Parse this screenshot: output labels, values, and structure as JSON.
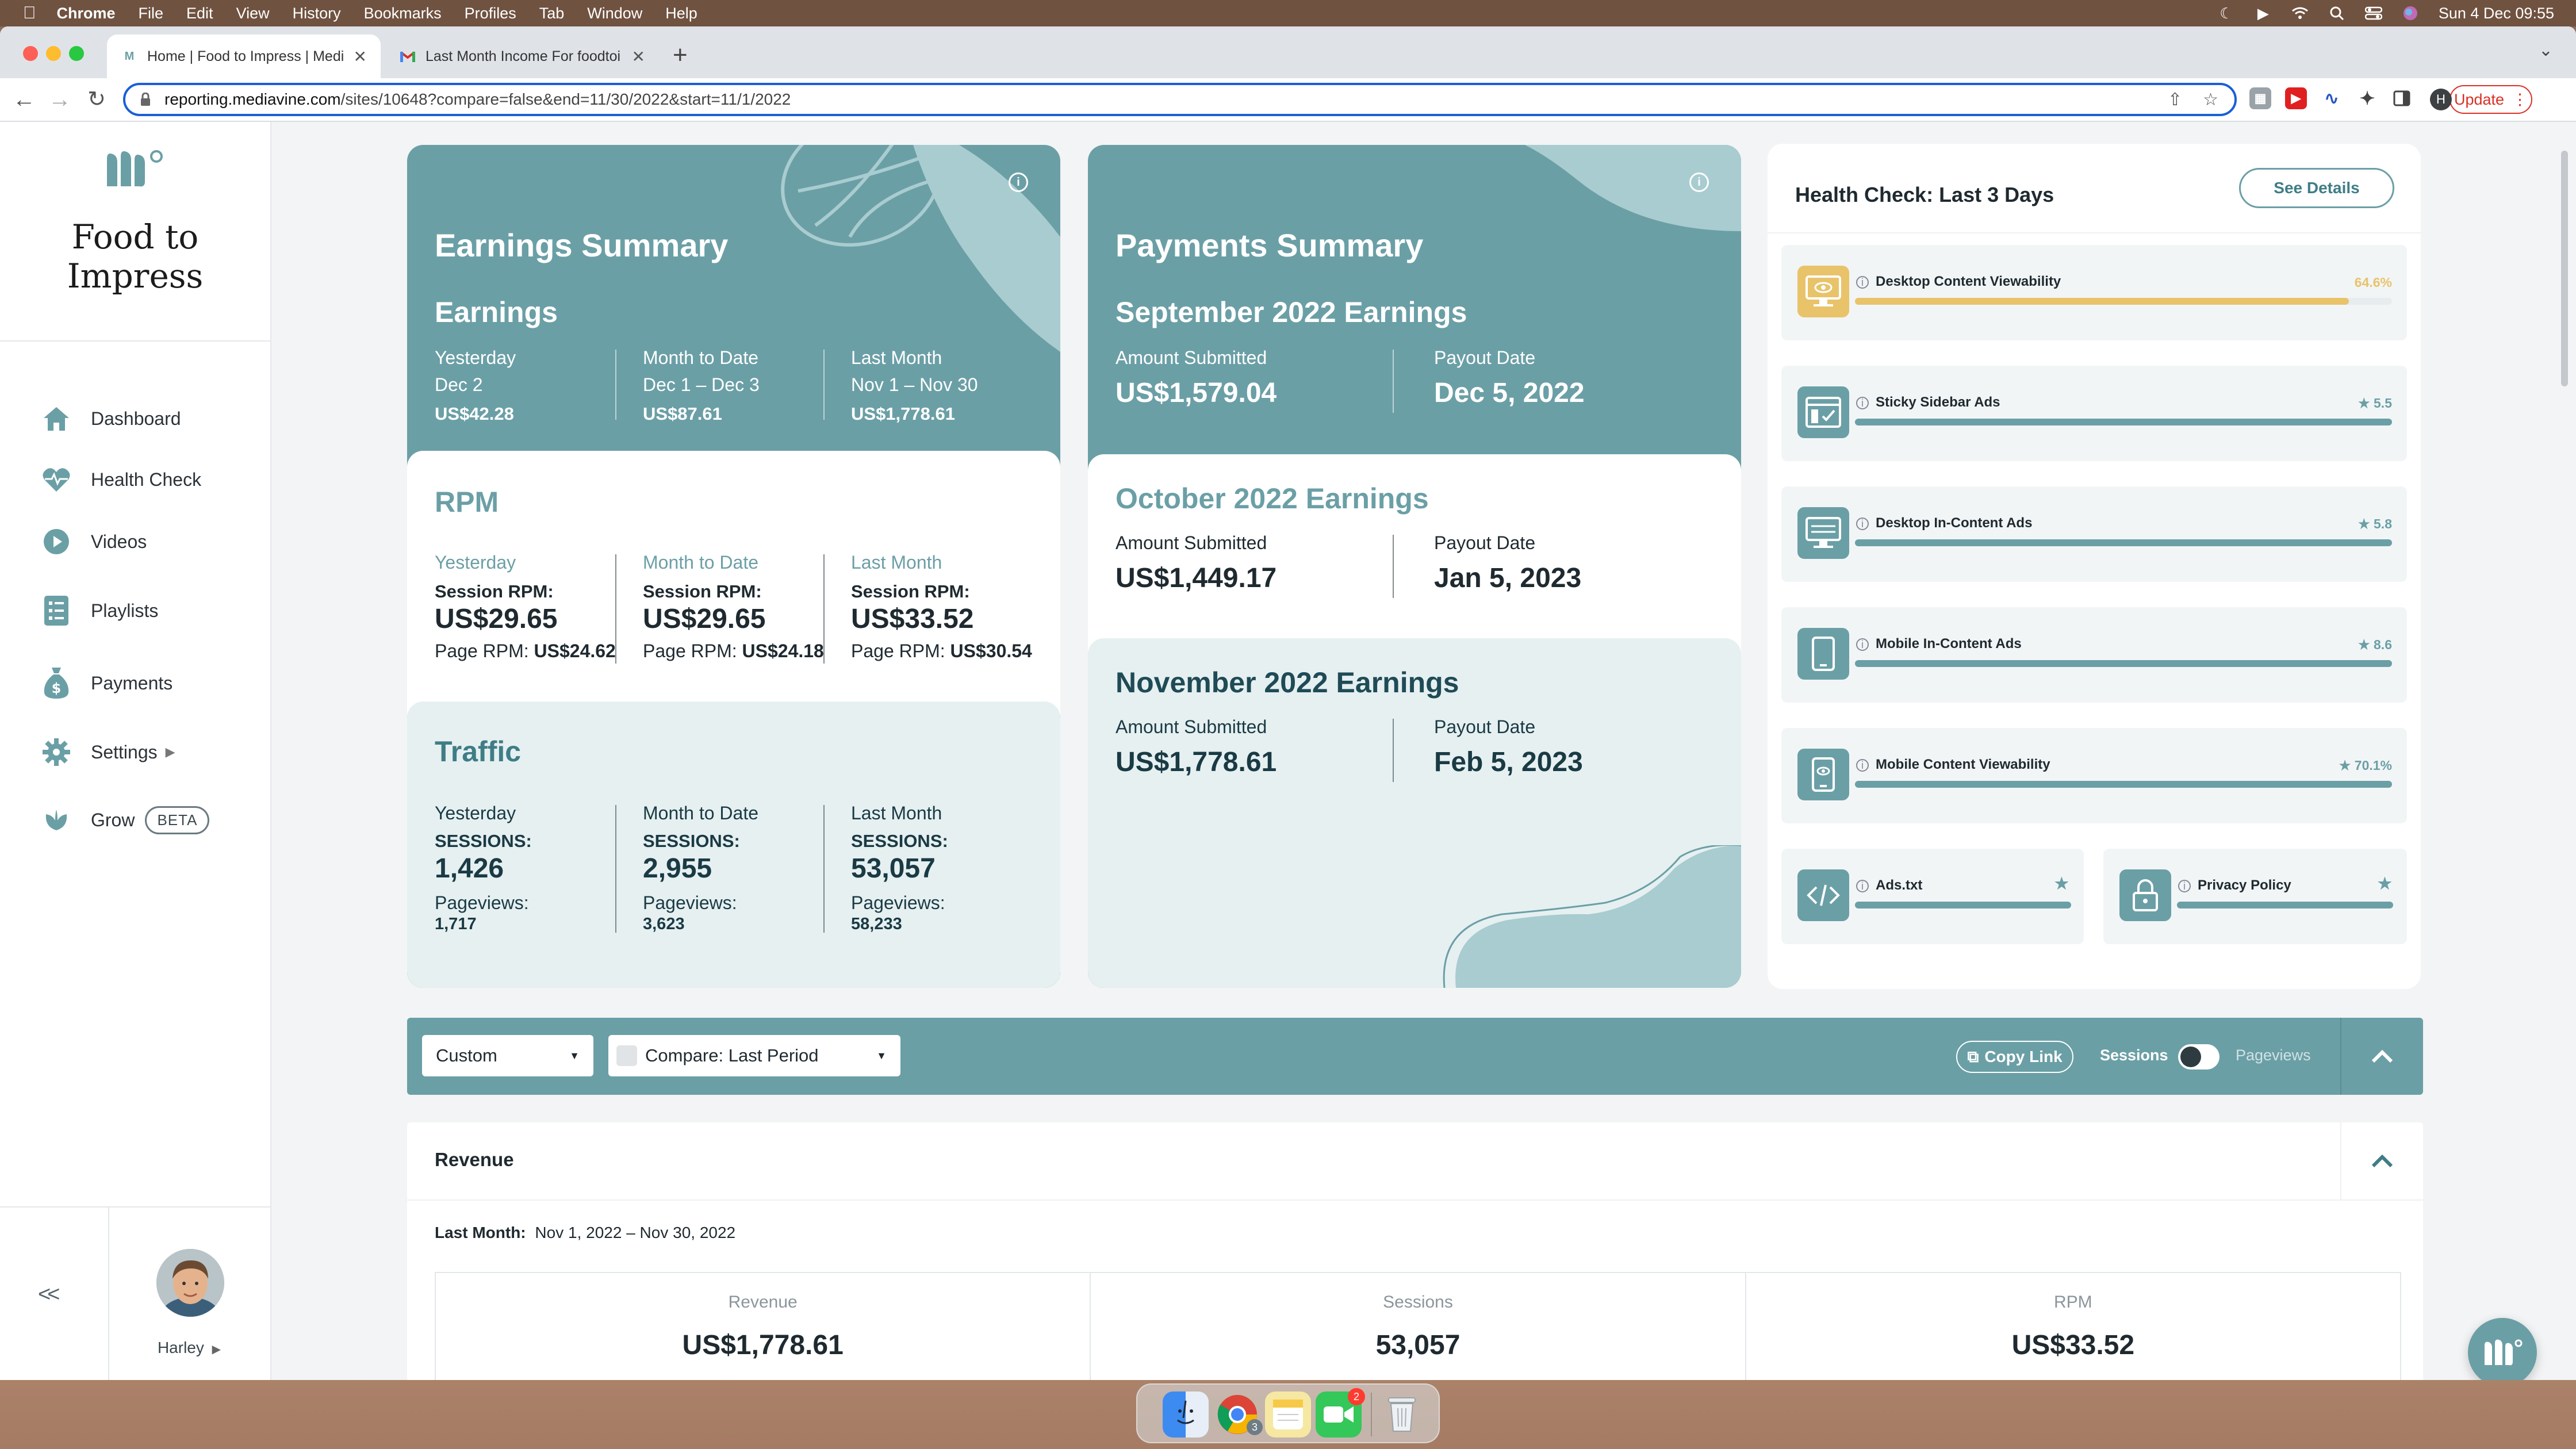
{
  "menubar": {
    "app": "Chrome",
    "items": [
      "File",
      "Edit",
      "View",
      "History",
      "Bookmarks",
      "Profiles",
      "Tab",
      "Window",
      "Help"
    ],
    "clock": "Sun 4 Dec  09:55"
  },
  "browser": {
    "tabs": [
      {
        "title": "Home | Food to Impress | Medi"
      },
      {
        "title": "Last Month Income For foodtoi"
      }
    ],
    "url_host": "reporting.mediavine.com",
    "url_path": "/sites/10648?compare=false&end=11/30/2022&start=11/1/2022",
    "update_label": "Update",
    "profile_initial": "H"
  },
  "sidebar": {
    "site_name_line1": "Food to",
    "site_name_line2": "Impress",
    "nav": [
      {
        "label": "Dashboard"
      },
      {
        "label": "Health Check"
      },
      {
        "label": "Videos"
      },
      {
        "label": "Playlists"
      },
      {
        "label": "Payments"
      },
      {
        "label": "Settings"
      },
      {
        "label": "Grow",
        "badge": "BETA"
      }
    ],
    "collapse_label": "<<",
    "user_name": "Harley"
  },
  "earnings": {
    "title": "Earnings Summary",
    "subtitle": "Earnings",
    "cols": [
      {
        "period": "Yesterday",
        "range": "Dec 2",
        "value": "US$42.28"
      },
      {
        "period": "Month to Date",
        "range": "Dec 1 – Dec 3",
        "value": "US$87.61"
      },
      {
        "period": "Last Month",
        "range": "Nov 1 – Nov 30",
        "value": "US$1,778.61"
      }
    ]
  },
  "rpm": {
    "title": "RPM",
    "session_label": "Session RPM:",
    "page_label": "Page RPM:",
    "cols": [
      {
        "period": "Yesterday",
        "session": "US$29.65",
        "page": "US$24.62"
      },
      {
        "period": "Month to Date",
        "session": "US$29.65",
        "page": "US$24.18"
      },
      {
        "period": "Last Month",
        "session": "US$33.52",
        "page": "US$30.54"
      }
    ]
  },
  "traffic": {
    "title": "Traffic",
    "sessions_label": "SESSIONS:",
    "pageviews_label": "Pageviews:",
    "cols": [
      {
        "period": "Yesterday",
        "sessions": "1,426",
        "pageviews": "1,717"
      },
      {
        "period": "Month to Date",
        "sessions": "2,955",
        "pageviews": "3,623"
      },
      {
        "period": "Last Month",
        "sessions": "53,057",
        "pageviews": "58,233"
      }
    ]
  },
  "payments": {
    "title": "Payments Summary",
    "amount_label": "Amount Submitted",
    "payout_label": "Payout Date",
    "months": [
      {
        "title": "September 2022 Earnings",
        "amount": "US$1,579.04",
        "payout": "Dec 5, 2022"
      },
      {
        "title": "October 2022 Earnings",
        "amount": "US$1,449.17",
        "payout": "Jan 5, 2023"
      },
      {
        "title": "November 2022 Earnings",
        "amount": "US$1,778.61",
        "payout": "Feb 5, 2023"
      }
    ]
  },
  "health": {
    "title": "Health Check: Last 3 Days",
    "details_button": "See Details",
    "items": [
      {
        "label": "Desktop Content Viewability",
        "score": "64.6%",
        "level": 0.92,
        "color": "#e8c36a"
      },
      {
        "label": "Sticky Sidebar Ads",
        "score": "5.5",
        "level": 1.0,
        "color": "#6b9fa6"
      },
      {
        "label": "Desktop In-Content Ads",
        "score": "5.8",
        "level": 1.0,
        "color": "#6b9fa6"
      },
      {
        "label": "Mobile In-Content Ads",
        "score": "8.6",
        "level": 1.0,
        "color": "#6b9fa6"
      },
      {
        "label": "Mobile Content Viewability",
        "score": "70.1%",
        "level": 1.0,
        "color": "#6b9fa6"
      },
      {
        "label": "Ads.txt",
        "score": "",
        "level": 1.0,
        "color": "#6b9fa6"
      },
      {
        "label": "Privacy Policy",
        "score": "",
        "level": 1.0,
        "color": "#6b9fa6"
      }
    ]
  },
  "filters": {
    "range_select": "Custom",
    "compare_select": "Compare: Last Period",
    "copy_link": "Copy Link",
    "toggle_left": "Sessions",
    "toggle_right": "Pageviews"
  },
  "revenue": {
    "title": "Revenue",
    "period_label": "Last Month:",
    "period_range": "Nov 1, 2022 – Nov 30, 2022",
    "stats": [
      {
        "label": "Revenue",
        "value": "US$1,778.61"
      },
      {
        "label": "Sessions",
        "value": "53,057"
      },
      {
        "label": "RPM",
        "value": "US$33.52"
      }
    ]
  },
  "dock": {
    "chrome_badge": "3",
    "facetime_badge": "2"
  },
  "colors": {
    "teal": "#6b9fa6",
    "pale_teal": "#e6f0f1",
    "teal_text": "#5d9199",
    "gold": "#e8c36a"
  }
}
